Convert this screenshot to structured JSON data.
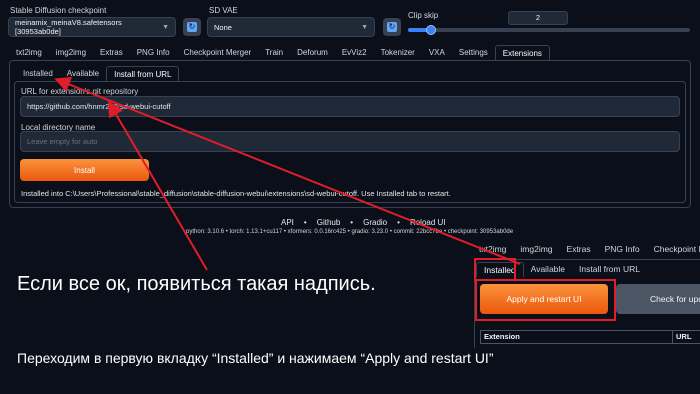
{
  "top": {
    "checkpoint_label": "Stable Diffusion checkpoint",
    "checkpoint_value": "meinamix_meinaV8.safetensors [30953ab0de]",
    "vae_label": "SD VAE",
    "vae_value": "None",
    "clip_label": "Clip skip",
    "clip_value": "2",
    "clip_fraction": 0.08
  },
  "tabs": [
    "txt2img",
    "img2img",
    "Extras",
    "PNG Info",
    "Checkpoint Merger",
    "Train",
    "Deforum",
    "EvViz2",
    "Tokenizer",
    "VXA",
    "Settings",
    "Extensions"
  ],
  "subtabs": [
    "Installed",
    "Available",
    "Install from URL"
  ],
  "install": {
    "url_label": "URL for extension's git repository",
    "url_value": "https://github.com/hnmr293/sd-webui-cutoff",
    "dir_label": "Local directory name",
    "dir_placeholder": "Leave empty for auto",
    "button": "Install",
    "message": "Installed into C:\\Users\\Professional\\stable_diffusion\\stable-diffusion-webui\\extensions\\sd-webui-cutoff. Use Installed tab to restart."
  },
  "footer": {
    "links": [
      "API",
      "Github",
      "Gradio",
      "Reload UI"
    ],
    "versions": "python: 3.10.6  •  torch: 1.13.1+cu117  •  xformers: 0.0.16rc425  •  gradio: 3.23.0  •  commit: 22bcc7be  •  checkpoint: 30953ab0de"
  },
  "inset": {
    "tabs": [
      "txt2img",
      "img2img",
      "Extras",
      "PNG Info",
      "Checkpoint Merger"
    ],
    "subtabs": [
      "Installed",
      "Available",
      "Install from URL"
    ],
    "apply_button": "Apply and restart UI",
    "check_button": "Check for updates",
    "col_extension": "Extension",
    "col_url": "URL"
  },
  "caption": {
    "line1": "Если все ок, появиться такая надпись.",
    "line2": "Переходим в первую вкладку “Installed” и нажимаем “Apply and restart UI”"
  },
  "colors": {
    "background": "#0b0f19",
    "accent_orange": "#f97316",
    "annotation_red": "#e11d2a",
    "slider_blue": "#3b82f6"
  }
}
